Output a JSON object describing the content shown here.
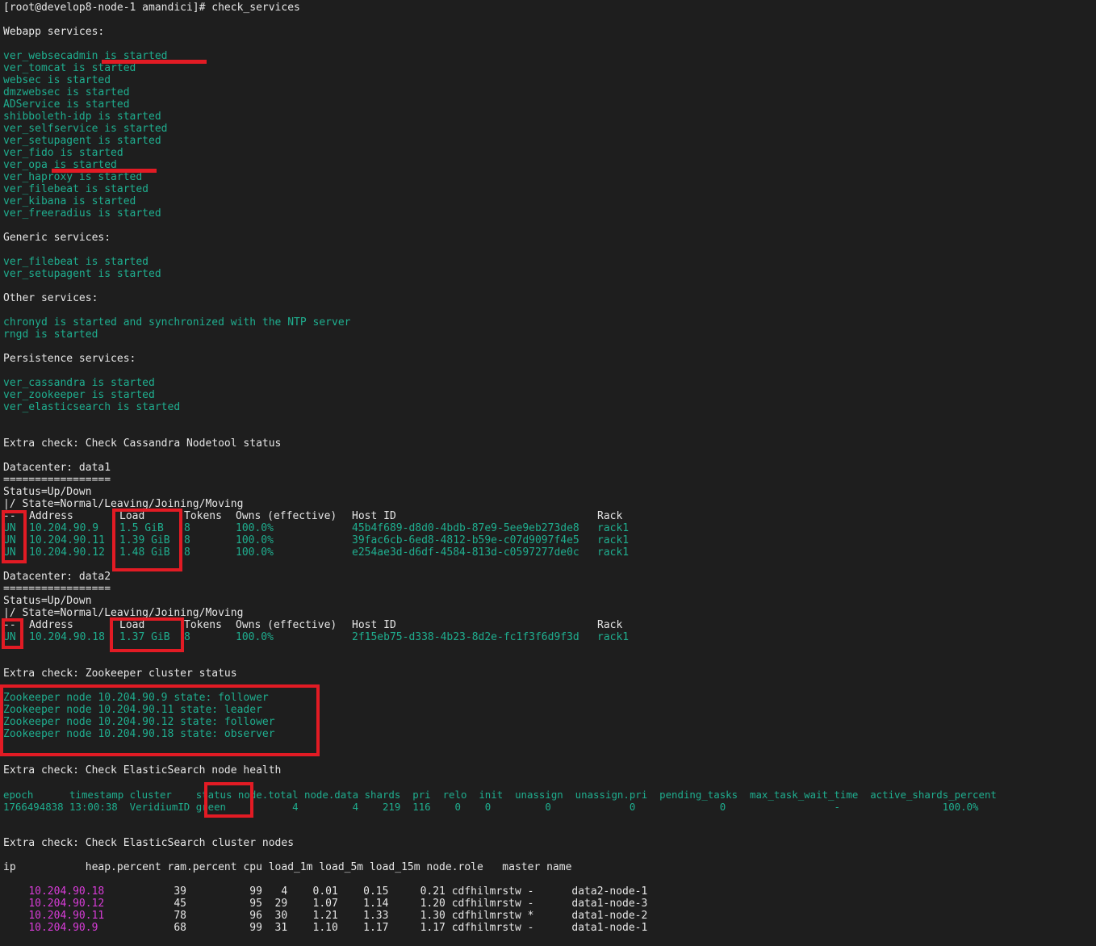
{
  "terminal": {
    "prompt": "[root@develop8-node-1 amandici]# check_services",
    "webapp_header": "Webapp services:",
    "webapp": [
      "ver_websecadmin is started",
      "ver_tomcat is started",
      "websec is started",
      "dmzwebsec is started",
      "ADService is started",
      "shibboleth-idp is started",
      "ver_selfservice is started",
      "ver_setupagent is started",
      "ver_fido is started",
      "ver_opa is started",
      "ver_haproxy is started",
      "ver_filebeat is started",
      "ver_kibana is started",
      "ver_freeradius is started"
    ],
    "generic_header": "Generic services:",
    "generic": [
      "ver_filebeat is started",
      "ver_setupagent is started"
    ],
    "other_header": "Other services:",
    "other": [
      "chronyd is started and synchronized with the NTP server",
      "rngd is started"
    ],
    "persistence_header": "Persistence services:",
    "persistence": [
      "ver_cassandra is started",
      "ver_zookeeper is started",
      "ver_elasticsearch is started"
    ],
    "cassandra_check": "Extra check: Check Cassandra Nodetool status",
    "dc1": {
      "title": "Datacenter: data1",
      "underline": "=================",
      "status_legend": "Status=Up/Down",
      "state_legend": "|/ State=Normal/Leaving/Joining/Moving",
      "header": [
        "--",
        "Address",
        "Load",
        "Tokens",
        "Owns (effective)",
        "Host ID",
        "Rack"
      ],
      "rows": [
        [
          "UN",
          "10.204.90.9",
          "1.5 GiB",
          "8",
          "100.0%",
          "45b4f689-d8d0-4bdb-87e9-5ee9eb273de8",
          "rack1"
        ],
        [
          "UN",
          "10.204.90.11",
          "1.39 GiB",
          "8",
          "100.0%",
          "39fac6cb-6ed8-4812-b59e-c07d9097f4e5",
          "rack1"
        ],
        [
          "UN",
          "10.204.90.12",
          "1.48 GiB",
          "8",
          "100.0%",
          "e254ae3d-d6df-4584-813d-c0597277de0c",
          "rack1"
        ]
      ]
    },
    "dc2": {
      "title": "Datacenter: data2",
      "underline": "=================",
      "status_legend": "Status=Up/Down",
      "state_legend": "|/ State=Normal/Leaving/Joining/Moving",
      "header": [
        "--",
        "Address",
        "Load",
        "Tokens",
        "Owns (effective)",
        "Host ID",
        "Rack"
      ],
      "rows": [
        [
          "UN",
          "10.204.90.18",
          "1.37 GiB",
          "8",
          "100.0%",
          "2f15eb75-d338-4b23-8d2e-fc1f3f6d9f3d",
          "rack1"
        ]
      ]
    },
    "zk_check": "Extra check: Zookeeper cluster status",
    "zk": [
      "Zookeeper node 10.204.90.9 state: follower",
      "Zookeeper node 10.204.90.11 state: leader",
      "Zookeeper node 10.204.90.12 state: follower",
      "Zookeeper node 10.204.90.18 state: observer"
    ],
    "es_health_check": "Extra check: Check ElasticSearch node health",
    "es_health_header": "epoch      timestamp cluster    status node.total node.data shards  pri  relo  init  unassign  unassign.pri  pending_tasks  max_task_wait_time  active_shards_percent",
    "es_health_row": "1766494838 13:00:38  VeridiumID green           4         4    219  116    0    0         0             0              0                  -                 100.0%",
    "es_nodes_check": "Extra check: Check ElasticSearch cluster nodes",
    "es_nodes_header": "ip           heap.percent ram.percent cpu load_1m load_5m load_15m node.role   master name",
    "es_nodes": [
      {
        "ip": "10.204.90.18",
        "rest": "           39          99   4    0.01    0.15     0.21 cdfhilmrstw -      data2-node-1"
      },
      {
        "ip": "10.204.90.12",
        "rest": "           45          95  29    1.07    1.14     1.20 cdfhilmrstw -      data1-node-3"
      },
      {
        "ip": "10.204.90.11",
        "rest": "           78          96  30    1.21    1.33     1.30 cdfhilmrstw *      data1-node-2"
      },
      {
        "ip": "10.204.90.9",
        "rest": "            68          99  31    1.10    1.17     1.17 cdfhilmrstw -      data1-node-1"
      }
    ],
    "colors": {
      "background": "#1e1e1e",
      "text": "#e6e6e6",
      "ok_green": "#1fae8f",
      "ip_magenta": "#d83cd8",
      "highlight_red": "#e21b24"
    }
  }
}
